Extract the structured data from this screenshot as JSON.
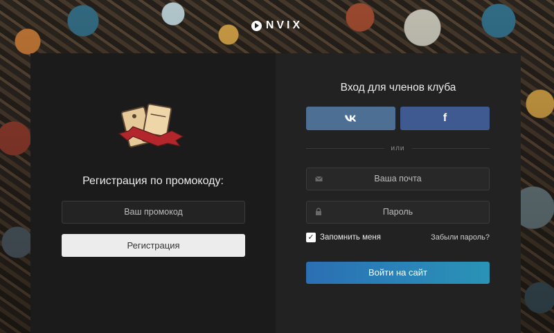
{
  "brand": {
    "logo_text": "NVIX"
  },
  "left": {
    "title": "Регистрация по промокоду:",
    "promo_placeholder": "Ваш промокод",
    "register_label": "Регистрация"
  },
  "right": {
    "title": "Вход для членов клуба",
    "vk_label": "vk",
    "fb_label": "f",
    "divider_text": "или",
    "email_placeholder": "Ваша почта",
    "password_placeholder": "Пароль",
    "remember_label": "Запомнить меня",
    "remember_checked": true,
    "forgot_label": "Забыли пароль?",
    "login_label": "Войти на сайт"
  },
  "colors": {
    "vk": "#4d6f94",
    "facebook": "#3e5a91",
    "login_accent": "#2a82b8"
  },
  "icons": [
    "play-icon",
    "ticket-icon",
    "vk-icon",
    "facebook-icon",
    "mail-icon",
    "lock-icon",
    "check-icon"
  ]
}
